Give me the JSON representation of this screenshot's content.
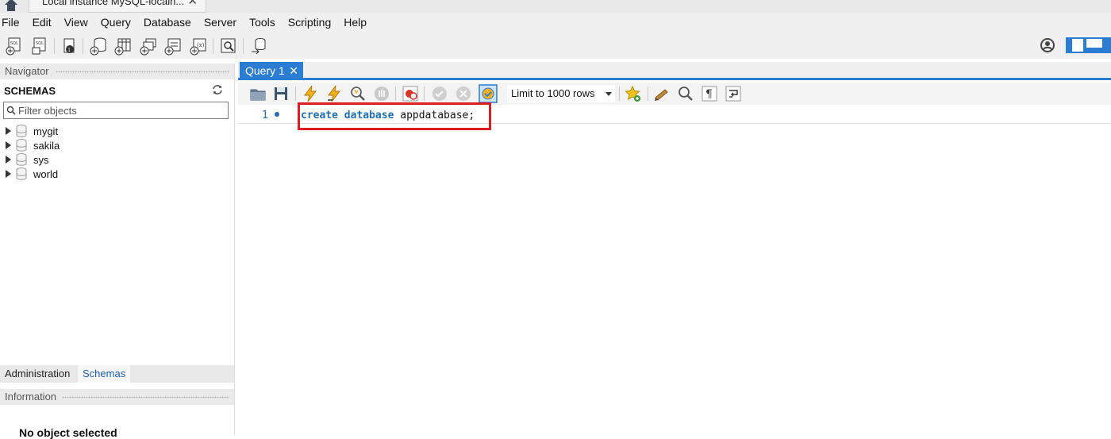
{
  "window": {
    "connection_tab": "Local instance MySQL-localh..."
  },
  "menu": [
    "File",
    "Edit",
    "View",
    "Query",
    "Database",
    "Server",
    "Tools",
    "Scripting",
    "Help"
  ],
  "navigator": {
    "header": "Navigator",
    "schemas_title": "SCHEMAS",
    "filter_placeholder": "Filter objects",
    "schemas": [
      "mygit",
      "sakila",
      "sys",
      "world"
    ],
    "tabs": [
      "Administration",
      "Schemas"
    ],
    "active_tab": "Schemas",
    "information_header": "Information",
    "no_object": "No object selected"
  },
  "editor": {
    "tab_label": "Query 1",
    "limit_label": "Limit to 1000 rows",
    "line_number": "1",
    "code": {
      "kw1": "create",
      "kw2": "database",
      "name": "appdatabase;"
    }
  },
  "colors": {
    "accent": "#2b7cd3",
    "keyword": "#1d6fb8",
    "highlight": "#e01b24"
  }
}
